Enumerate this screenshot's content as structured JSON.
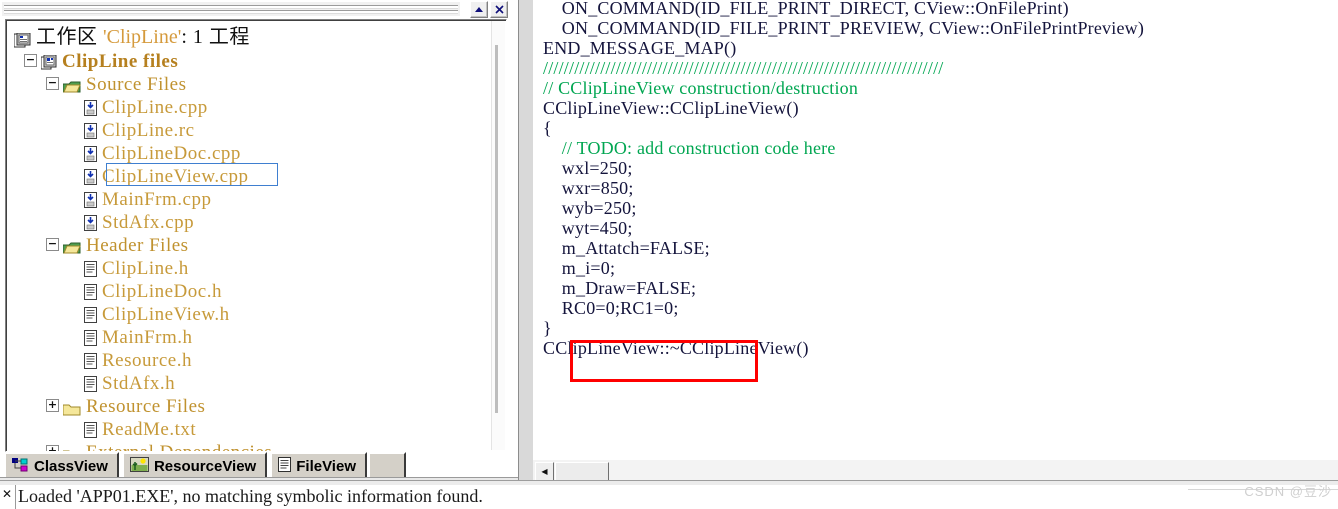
{
  "window": {
    "minimize_label": "minimize",
    "close_label": "✕"
  },
  "workspace": {
    "root_prefix": "工作区 ",
    "root_quoted": "'ClipLine'",
    "root_suffix": ": 1 工程",
    "project_label": "ClipLine files",
    "root_icon": "workspace-icon",
    "project_icon": "project-icon",
    "nodes": [
      {
        "label": "Source Files",
        "kind": "folder",
        "expander": "−",
        "indent": 1,
        "icon": "folder-open-icon"
      },
      {
        "label": "ClipLine.cpp",
        "kind": "cpp",
        "expander": "",
        "indent": 2,
        "icon": "cpp-file-icon"
      },
      {
        "label": "ClipLine.rc",
        "kind": "cpp",
        "expander": "",
        "indent": 2,
        "icon": "cpp-file-icon"
      },
      {
        "label": "ClipLineDoc.cpp",
        "kind": "cpp",
        "expander": "",
        "indent": 2,
        "icon": "cpp-file-icon"
      },
      {
        "label": "ClipLineView.cpp",
        "kind": "cpp",
        "expander": "",
        "indent": 2,
        "icon": "cpp-file-icon",
        "selected": true
      },
      {
        "label": "MainFrm.cpp",
        "kind": "cpp",
        "expander": "",
        "indent": 2,
        "icon": "cpp-file-icon"
      },
      {
        "label": "StdAfx.cpp",
        "kind": "cpp",
        "expander": "",
        "indent": 2,
        "icon": "cpp-file-icon"
      },
      {
        "label": "Header Files",
        "kind": "folder",
        "expander": "−",
        "indent": 1,
        "icon": "folder-open-icon"
      },
      {
        "label": "ClipLine.h",
        "kind": "header",
        "expander": "",
        "indent": 2,
        "icon": "header-file-icon"
      },
      {
        "label": "ClipLineDoc.h",
        "kind": "header",
        "expander": "",
        "indent": 2,
        "icon": "header-file-icon"
      },
      {
        "label": "ClipLineView.h",
        "kind": "header",
        "expander": "",
        "indent": 2,
        "icon": "header-file-icon"
      },
      {
        "label": "MainFrm.h",
        "kind": "header",
        "expander": "",
        "indent": 2,
        "icon": "header-file-icon"
      },
      {
        "label": "Resource.h",
        "kind": "header",
        "expander": "",
        "indent": 2,
        "icon": "header-file-icon"
      },
      {
        "label": "StdAfx.h",
        "kind": "header",
        "expander": "",
        "indent": 2,
        "icon": "header-file-icon"
      },
      {
        "label": "Resource Files",
        "kind": "folder",
        "expander": "+",
        "indent": 1,
        "icon": "folder-closed-icon"
      },
      {
        "label": "ReadMe.txt",
        "kind": "header",
        "expander": "",
        "indent": 2,
        "icon": "text-file-icon"
      },
      {
        "label": "External Dependencies",
        "kind": "folder",
        "expander": "+",
        "indent": 1,
        "icon": "folder-closed-icon"
      }
    ]
  },
  "tabs": [
    {
      "label": "ClassView",
      "icon": "classview-icon",
      "active": false
    },
    {
      "label": "ResourceView",
      "icon": "resourceview-icon",
      "active": true
    },
    {
      "label": "FileView",
      "icon": "fileview-icon",
      "active": false
    }
  ],
  "editor": {
    "lines": [
      {
        "text": "    ON_COMMAND(ID_FILE_PRINT_DIRECT, CView::OnFilePrint)",
        "style": "code"
      },
      {
        "text": "    ON_COMMAND(ID_FILE_PRINT_PREVIEW, CView::OnFilePrintPreview)",
        "style": "code"
      },
      {
        "text": "END_MESSAGE_MAP()",
        "style": "code"
      },
      {
        "text": "",
        "style": "code"
      },
      {
        "text": "",
        "style": "code"
      },
      {
        "text": "/////////////////////////////////////////////////////////////////////////////",
        "style": "comment"
      },
      {
        "text": "// CClipLineView construction/destruction",
        "style": "comment"
      },
      {
        "text": "",
        "style": "code"
      },
      {
        "text": "CClipLineView::CClipLineView()",
        "style": "code"
      },
      {
        "text": "{",
        "style": "code"
      },
      {
        "text": "    // TODO: add construction code here",
        "style": "comment"
      },
      {
        "text": "    wxl=250;",
        "style": "code"
      },
      {
        "text": "    wxr=850;",
        "style": "code"
      },
      {
        "text": "    wyb=250;",
        "style": "code"
      },
      {
        "text": "    wyt=450;",
        "style": "code"
      },
      {
        "text": "    m_Attatch=FALSE;",
        "style": "code"
      },
      {
        "text": "    m_i=0;",
        "style": "code"
      },
      {
        "text": "    m_Draw=FALSE;",
        "style": "code"
      },
      {
        "text": "    RC0=0;RC1=0;",
        "style": "code"
      },
      {
        "text": "",
        "style": "code"
      },
      {
        "text": "",
        "style": "code"
      },
      {
        "text": "}",
        "style": "code"
      },
      {
        "text": "",
        "style": "code"
      },
      {
        "text": "CClipLineView::~CClipLineView()",
        "style": "code"
      }
    ],
    "hscroll_arrow": "◀",
    "annotation_target": "RC0=0;RC1=0;"
  },
  "output": {
    "close_label": "✕",
    "text": "Loaded 'APP01.EXE', no matching symbolic information found."
  },
  "watermark": {
    "text": "CSDN @豆沙"
  },
  "colors": {
    "comment_green": "#00a651",
    "code_navy": "#14143c",
    "tree_gold": "#c79a3a",
    "annotation_red": "#ff0000",
    "selection_blue": "#3f7fd0"
  }
}
